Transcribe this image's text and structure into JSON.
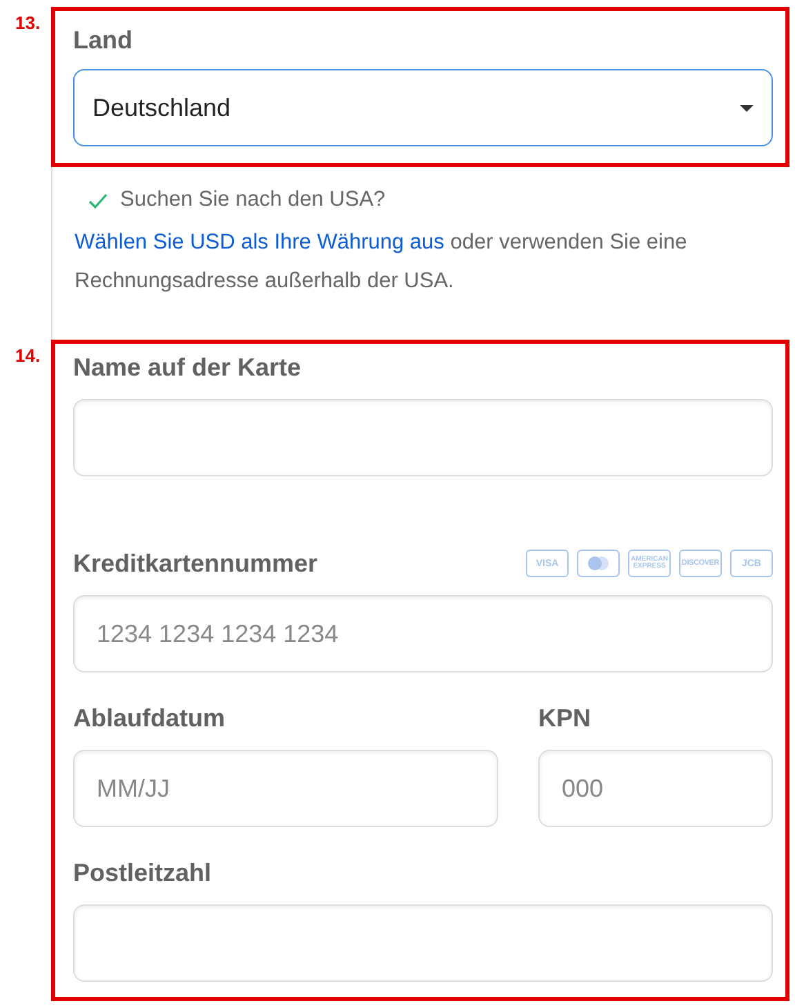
{
  "country_section": {
    "number": "13.",
    "label": "Land",
    "value": "Deutschland"
  },
  "notice": {
    "check_text": "Suchen Sie nach den USA?",
    "link": "Wählen Sie USD als Ihre Währung aus",
    "text": " oder verwenden Sie eine Rechnungsadresse außerhalb der USA."
  },
  "card_section": {
    "number": "14.",
    "rows": [
      {
        "fields": [
          {
            "label": "Name auf der Karte"
          }
        ]
      },
      {
        "fields": [
          {
            "label": "Kreditkartennummer",
            "placeholder": "1234 1234 1234 1234",
            "brands": [
              {
                "kind": "text",
                "label": "VISA"
              },
              {
                "kind": "circles"
              },
              {
                "kind": "text",
                "label": "AMERICAN EXPRESS"
              },
              {
                "kind": "text",
                "label": "DISCOVER"
              },
              {
                "kind": "text",
                "label": "JCB"
              }
            ]
          }
        ]
      },
      {
        "fields": [
          {
            "label": "Ablaufdatum",
            "placeholder": "MM/JJ"
          },
          {
            "label": "KPN",
            "placeholder": "000"
          }
        ]
      },
      {
        "fields": [
          {
            "label": "Postleitzahl"
          }
        ]
      }
    ]
  }
}
